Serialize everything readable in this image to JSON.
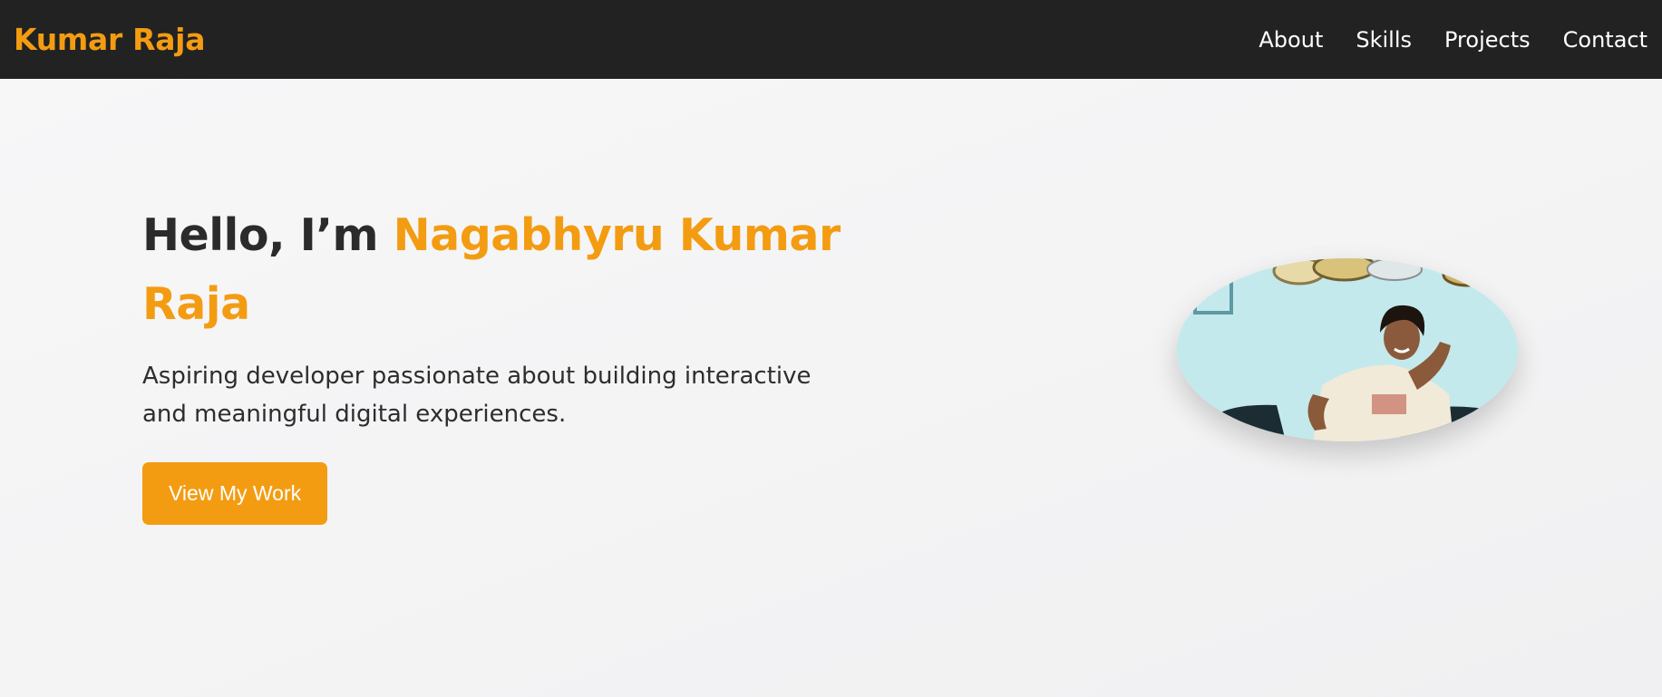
{
  "nav": {
    "brand": "Kumar Raja",
    "links": [
      "About",
      "Skills",
      "Projects",
      "Contact"
    ]
  },
  "hero": {
    "greeting": "Hello, I’m",
    "name": "Nagabhyru Kumar Raja",
    "subtitle": "Aspiring developer passionate about building interactive and meaningful digital experiences.",
    "cta_label": "View My Work"
  },
  "colors": {
    "accent": "#f39c12",
    "nav_bg": "#222222",
    "text_dark": "#2b2b2b"
  },
  "icons": {
    "portrait": "profile-photo"
  }
}
